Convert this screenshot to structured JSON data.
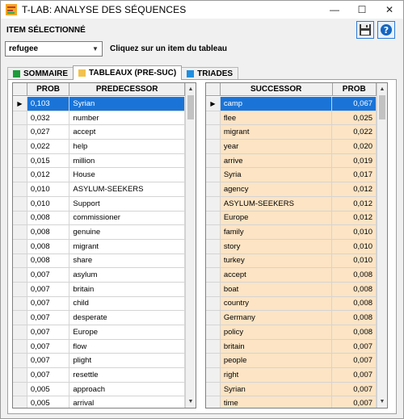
{
  "window": {
    "title": "T-LAB: ANALYSE DES SÉQUENCES",
    "minimize": "—",
    "maximize": "☐",
    "close": "✕"
  },
  "header": {
    "label": "ITEM SÉLECTIONNÉ",
    "icons": [
      "save-icon",
      "help-icon"
    ],
    "help_glyph": "?"
  },
  "item_select": {
    "value": "refugee",
    "arrow": "▼"
  },
  "hint": "Cliquez sur un item du tableau",
  "tabs": [
    {
      "label": "SOMMAIRE",
      "color": "#1e9b3a",
      "active": false
    },
    {
      "label": "TABLEAUX (PRE-SUC)",
      "color": "#f2c24e",
      "active": true
    },
    {
      "label": "TRIADES",
      "color": "#1f8fe0",
      "active": false
    }
  ],
  "predecessor_table": {
    "columns": [
      "PROB",
      "PREDECESSOR"
    ],
    "rows": [
      [
        "0,103",
        "Syrian"
      ],
      [
        "0,032",
        "number"
      ],
      [
        "0,027",
        "accept"
      ],
      [
        "0,022",
        "help"
      ],
      [
        "0,015",
        "million"
      ],
      [
        "0,012",
        "House"
      ],
      [
        "0,010",
        "ASYLUM-SEEKERS"
      ],
      [
        "0,010",
        "Support"
      ],
      [
        "0,008",
        "commissioner"
      ],
      [
        "0,008",
        "genuine"
      ],
      [
        "0,008",
        "migrant"
      ],
      [
        "0,008",
        "share"
      ],
      [
        "0,007",
        "asylum"
      ],
      [
        "0,007",
        "britain"
      ],
      [
        "0,007",
        "child"
      ],
      [
        "0,007",
        "desperate"
      ],
      [
        "0,007",
        "Europe"
      ],
      [
        "0,007",
        "flow"
      ],
      [
        "0,007",
        "plight"
      ],
      [
        "0,007",
        "resettle"
      ],
      [
        "0,005",
        "approach"
      ],
      [
        "0,005",
        "arrival"
      ]
    ],
    "selected_row": 0
  },
  "successor_table": {
    "columns": [
      "SUCCESSOR",
      "PROB"
    ],
    "rows": [
      [
        "camp",
        "0,067"
      ],
      [
        "flee",
        "0,025"
      ],
      [
        "migrant",
        "0,022"
      ],
      [
        "year",
        "0,020"
      ],
      [
        "arrive",
        "0,019"
      ],
      [
        "Syria",
        "0,017"
      ],
      [
        "agency",
        "0,012"
      ],
      [
        "ASYLUM-SEEKERS",
        "0,012"
      ],
      [
        "Europe",
        "0,012"
      ],
      [
        "family",
        "0,010"
      ],
      [
        "story",
        "0,010"
      ],
      [
        "turkey",
        "0,010"
      ],
      [
        "accept",
        "0,008"
      ],
      [
        "boat",
        "0,008"
      ],
      [
        "country",
        "0,008"
      ],
      [
        "Germany",
        "0,008"
      ],
      [
        "policy",
        "0,008"
      ],
      [
        "britain",
        "0,007"
      ],
      [
        "people",
        "0,007"
      ],
      [
        "right",
        "0,007"
      ],
      [
        "Syrian",
        "0,007"
      ],
      [
        "time",
        "0,007"
      ]
    ],
    "selected_row": 0
  },
  "row_indicator": "▶",
  "scroll_arrows": {
    "up": "▲",
    "down": "▼"
  }
}
